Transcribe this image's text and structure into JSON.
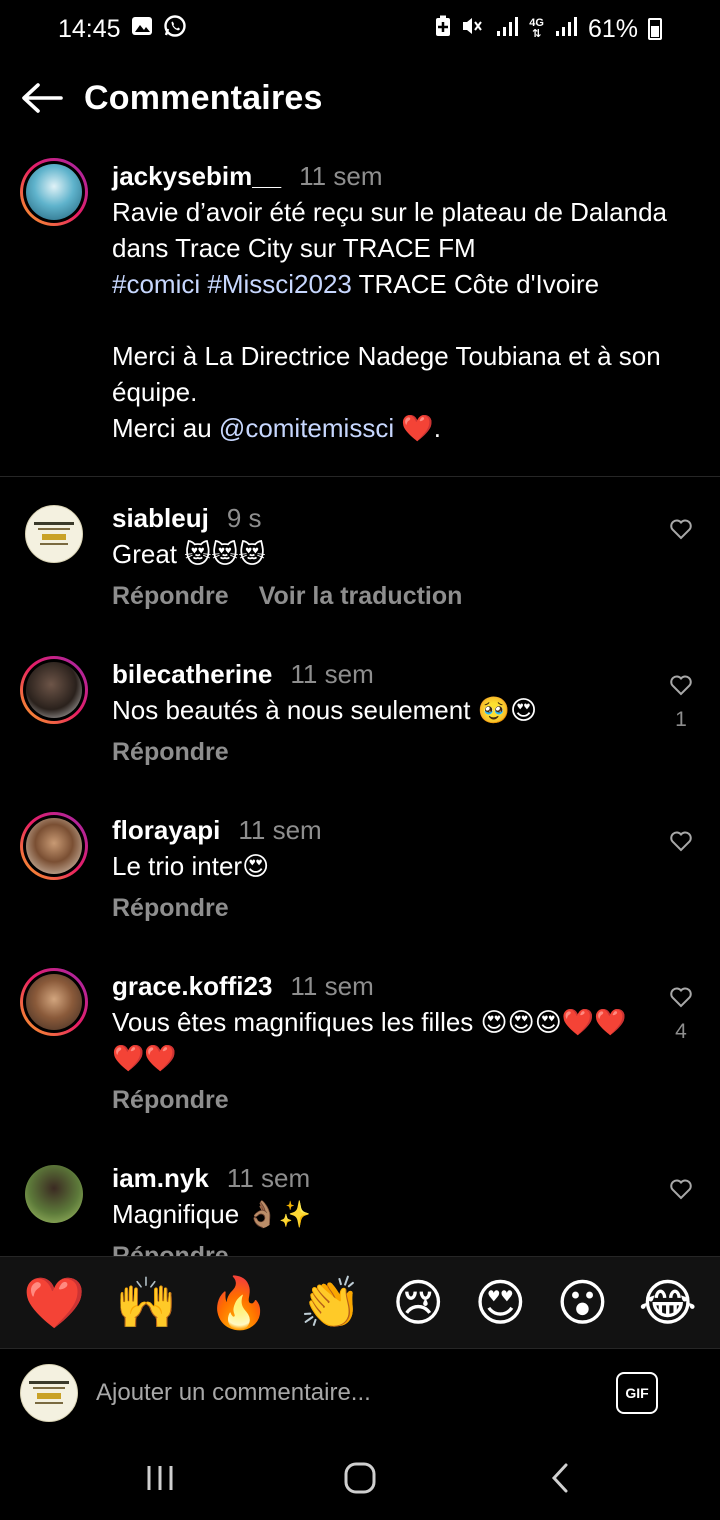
{
  "status_bar": {
    "time": "14:45",
    "battery": "61%",
    "network": "4G"
  },
  "header": {
    "title": "Commentaires"
  },
  "caption": {
    "username": "jackysebim__",
    "time": "11 sem",
    "line1": "Ravie d’avoir été reçu sur le plateau de Dalanda dans Trace City sur TRACE FM",
    "hashtag1": "#comici",
    "hashtag2": "#Missci2023",
    "line2_rest": " TRACE Côte d'Ivoire",
    "line3": "Merci à La Directrice Nadege Toubiana et à son équipe.",
    "line4_prefix": "Merci au ",
    "mention": "@comitemissci",
    "line4_suffix": " ❤️."
  },
  "comments": [
    {
      "username": "siableuj",
      "time": "9 s",
      "text": "Great 😻😻😻",
      "reply": "Répondre",
      "translate": "Voir la traduction",
      "likes": ""
    },
    {
      "username": "bilecatherine",
      "time": "11 sem",
      "text": "Nos beautés à nous seulement 🥹😍",
      "reply": "Répondre",
      "likes": "1"
    },
    {
      "username": "florayapi",
      "time": "11 sem",
      "text": "Le trio inter😍",
      "reply": "Répondre",
      "likes": ""
    },
    {
      "username": "grace.koffi23",
      "time": "11 sem",
      "text": "Vous êtes magnifiques les filles 😍😍😍❤️❤️❤️❤️",
      "reply": "Répondre",
      "likes": "4"
    },
    {
      "username": "iam.nyk",
      "time": "11 sem",
      "text": "Magnifique 👌🏽✨",
      "reply": "Répondre",
      "likes": ""
    }
  ],
  "emoji_bar": [
    "❤️",
    "🙌",
    "🔥",
    "👏",
    "😢",
    "😍",
    "😮",
    "😂"
  ],
  "input": {
    "placeholder": "Ajouter un commentaire...",
    "gif_label": "GIF"
  },
  "colors": {
    "background": "#000000",
    "muted": "#8e8e8e",
    "link": "#c7d7fe"
  }
}
